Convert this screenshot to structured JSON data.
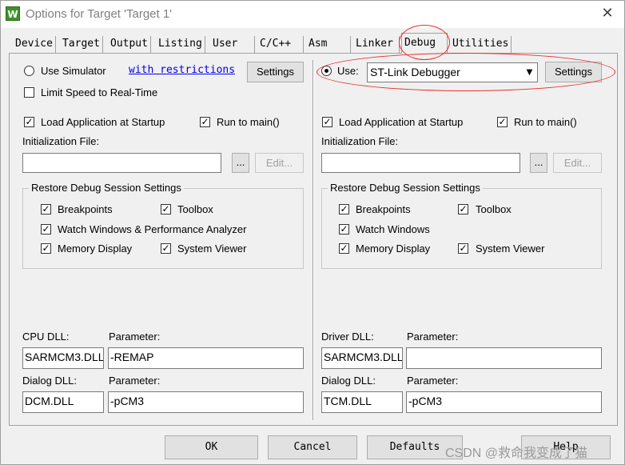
{
  "window": {
    "title": "Options for Target 'Target 1'",
    "close_glyph": "✕",
    "app_icon_glyph": "W"
  },
  "tabs": [
    {
      "label": "Device"
    },
    {
      "label": "Target"
    },
    {
      "label": "Output"
    },
    {
      "label": "Listing"
    },
    {
      "label": "User"
    },
    {
      "label": "C/C++"
    },
    {
      "label": "Asm"
    },
    {
      "label": "Linker"
    },
    {
      "label": "Debug"
    },
    {
      "label": "Utilities"
    }
  ],
  "active_tab": "Debug",
  "left": {
    "use_simulator": {
      "label": "Use Simulator",
      "selected": false
    },
    "restrictions_link": "with restrictions",
    "settings_button": "Settings",
    "limit_speed": {
      "label": "Limit Speed to Real-Time",
      "checked": false
    },
    "load_app": {
      "label": "Load Application at Startup",
      "checked": true
    },
    "run_to_main": {
      "label": "Run to main()",
      "checked": true
    },
    "init_file_label": "Initialization File:",
    "init_file_value": "",
    "browse_button": "...",
    "edit_button": "Edit...",
    "restore_group": {
      "title": "Restore Debug Session Settings",
      "breakpoints": "Breakpoints",
      "toolbox": "Toolbox",
      "watch_windows": "Watch Windows & Performance Analyzer",
      "memory_display": "Memory Display",
      "system_viewer": "System Viewer"
    },
    "dll1_label": "CPU DLL:",
    "param1_label": "Parameter:",
    "dll1_value": "SARMCM3.DLL",
    "param1_value": "-REMAP",
    "dll2_label": "Dialog DLL:",
    "param2_label": "Parameter:",
    "dll2_value": "DCM.DLL",
    "param2_value": "-pCM3"
  },
  "right": {
    "use_label": "Use:",
    "use_selected": true,
    "debugger_value": "ST-Link Debugger",
    "settings_button": "Settings",
    "load_app": {
      "label": "Load Application at Startup",
      "checked": true
    },
    "run_to_main": {
      "label": "Run to main()",
      "checked": true
    },
    "init_file_label": "Initialization File:",
    "init_file_value": "",
    "browse_button": "...",
    "edit_button": "Edit...",
    "restore_group": {
      "title": "Restore Debug Session Settings",
      "breakpoints": "Breakpoints",
      "toolbox": "Toolbox",
      "watch_windows": "Watch Windows",
      "memory_display": "Memory Display",
      "system_viewer": "System Viewer"
    },
    "dll1_label": "Driver DLL:",
    "param1_label": "Parameter:",
    "dll1_value": "SARMCM3.DLL",
    "param1_value": "",
    "dll2_label": "Dialog DLL:",
    "param2_label": "Parameter:",
    "dll2_value": "TCM.DLL",
    "param2_value": "-pCM3"
  },
  "footer": {
    "ok": "OK",
    "cancel": "Cancel",
    "defaults": "Defaults",
    "help": "Help"
  },
  "watermark": "CSDN @救命我变成了猫",
  "colors": {
    "annotation": "#e53030",
    "link": "#0000ee",
    "icon_green": "#3f8f2c"
  }
}
